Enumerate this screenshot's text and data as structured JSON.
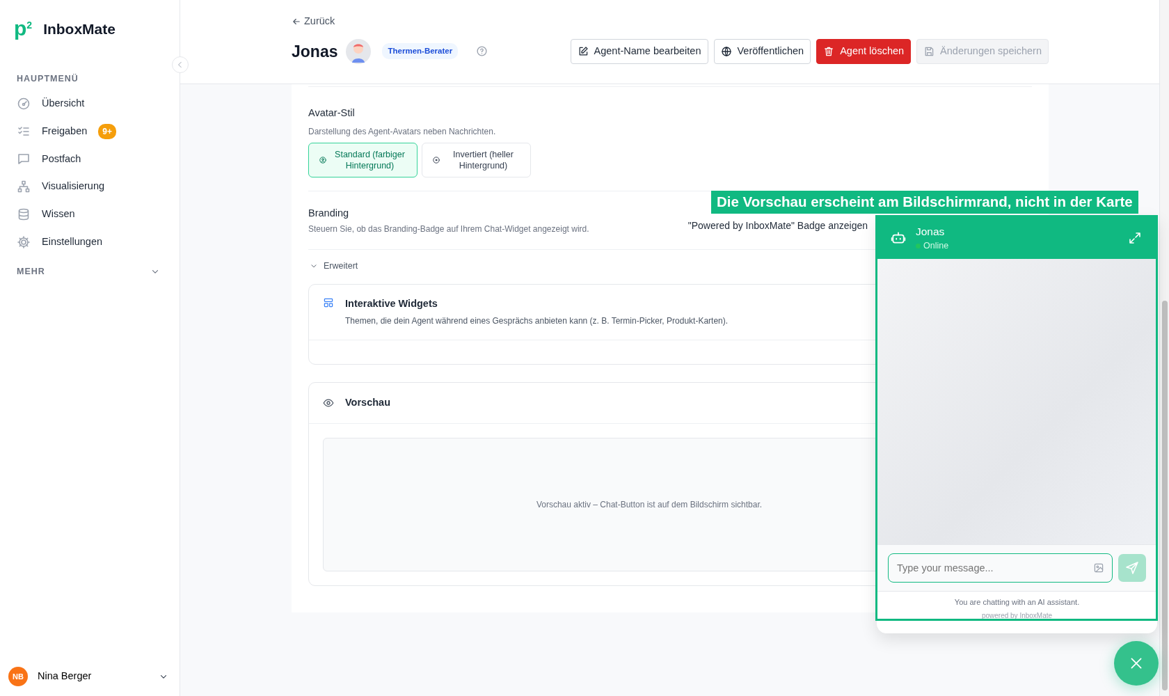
{
  "sidebar": {
    "logo": {
      "mark": "p",
      "sup": "2",
      "name": "InboxMate"
    },
    "section": "HAUPTMENÜ",
    "items": [
      {
        "label": "Übersicht",
        "selected": false
      },
      {
        "label": "Freigaben",
        "badge": "9+",
        "selected": false
      },
      {
        "label": "Postfach",
        "selected": false
      },
      {
        "label": "Visualisierung",
        "selected": false
      },
      {
        "label": "Wissen",
        "selected": false
      },
      {
        "label": "Einstellungen",
        "selected": false
      }
    ],
    "more": {
      "label": "MEHR",
      "expanded": false
    },
    "user": {
      "initials": "NB",
      "name": "Nina Berger"
    }
  },
  "header": {
    "back": "Zurück",
    "title": "Jonas",
    "tag": "Thermen-Berater",
    "buttons": [
      {
        "label": "Agent-Name bearbeiten",
        "kind": "outline",
        "disabled": false
      },
      {
        "label": "Veröffentlichen",
        "kind": "outline",
        "disabled": false
      },
      {
        "label": "Agent löschen",
        "kind": "danger",
        "disabled": false
      },
      {
        "label": "Änderungen speichern",
        "kind": "outline",
        "disabled": true
      }
    ]
  },
  "avatar_style": {
    "title": "Avatar-Stil",
    "description": "Darstellung des Agent-Avatars neben Nachrichten.",
    "options": [
      {
        "label": "Standard (farbiger Hintergrund)",
        "selected": true
      },
      {
        "label": "Invertiert (heller Hintergrund)",
        "selected": false
      }
    ]
  },
  "branding": {
    "title": "Branding",
    "description": "Steuern Sie, ob das Branding-Badge auf Ihrem Chat-Widget angezeigt wird.",
    "toggle_label": "\"Powered by InboxMate\" Badge anzeigen"
  },
  "advanced": {
    "label": "Erweitert",
    "expanded": true
  },
  "widgets_card": {
    "title": "Interaktive Widgets",
    "description": "Themen, die dein Agent während eines Gesprächs anbieten kann (z. B. Termin-Picker, Produkt-Karten)."
  },
  "preview_card": {
    "title": "Vorschau",
    "message": "Vorschau aktiv – Chat-Button ist auf dem Bildschirm sichtbar."
  },
  "banner": "Die Vorschau erscheint am Bildschirmrand, nicht in der Karte",
  "chat": {
    "name": "Jonas",
    "status": "Online",
    "placeholder": "Type your message...",
    "notice": "You are chatting with an AI assistant.",
    "powered": "powered by InboxMate"
  }
}
